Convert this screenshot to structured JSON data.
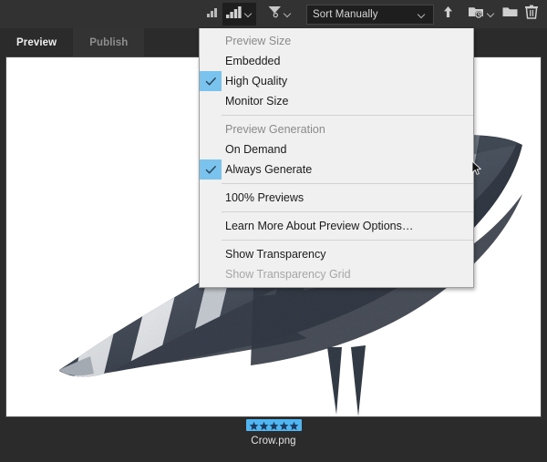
{
  "app": {
    "accent_blue": "#51b5f0",
    "check_highlight": "#79c3ee",
    "toolbar_bg": "#323232",
    "panel_bg": "#2b2b2b",
    "menu_bg": "#f0f0f0"
  },
  "toolbar": {
    "thumbnail_size_small_icon": "thumbnail-size-small-icon",
    "thumbnail_size_large_icon": "thumbnail-size-large-icon",
    "filter_icon": "filter-funnel-icon",
    "sort_value": "Sort Manually",
    "sort_placeholder": "Sort Manually",
    "sort_chevron_icon": "chevron-down-icon",
    "sort_direction_icon": "arrow-up-icon",
    "recent_folders_icon": "recent-folder-icon",
    "new_folder_icon": "folder-icon",
    "delete_icon": "trash-icon"
  },
  "tabs": [
    {
      "label": "Preview",
      "selected": true
    },
    {
      "label": "Publish",
      "selected": false
    }
  ],
  "menu": {
    "groups": [
      {
        "header": "Preview Size",
        "items": [
          {
            "label": "Embedded",
            "checked": false,
            "disabled": false
          },
          {
            "label": "High Quality",
            "checked": true,
            "disabled": false
          },
          {
            "label": "Monitor Size",
            "checked": false,
            "disabled": false
          }
        ]
      },
      {
        "header": "Preview Generation",
        "items": [
          {
            "label": "On Demand",
            "checked": false,
            "disabled": false
          },
          {
            "label": "Always Generate",
            "checked": true,
            "disabled": false
          }
        ]
      },
      {
        "header": null,
        "items": [
          {
            "label": "100% Previews",
            "checked": false,
            "disabled": false
          }
        ]
      },
      {
        "header": null,
        "items": [
          {
            "label": "Learn More About Preview Options…",
            "checked": false,
            "disabled": false
          }
        ]
      },
      {
        "header": null,
        "items": [
          {
            "label": "Show Transparency",
            "checked": false,
            "disabled": false
          },
          {
            "label": "Show Transparency Grid",
            "checked": false,
            "disabled": true
          }
        ]
      }
    ]
  },
  "canvas": {
    "artwork_name": "crow-illustration"
  },
  "thumbnail": {
    "rating": 5,
    "max_rating": 5,
    "filename": "Crow.png"
  },
  "cursor": {
    "icon": "mouse-pointer-icon"
  }
}
